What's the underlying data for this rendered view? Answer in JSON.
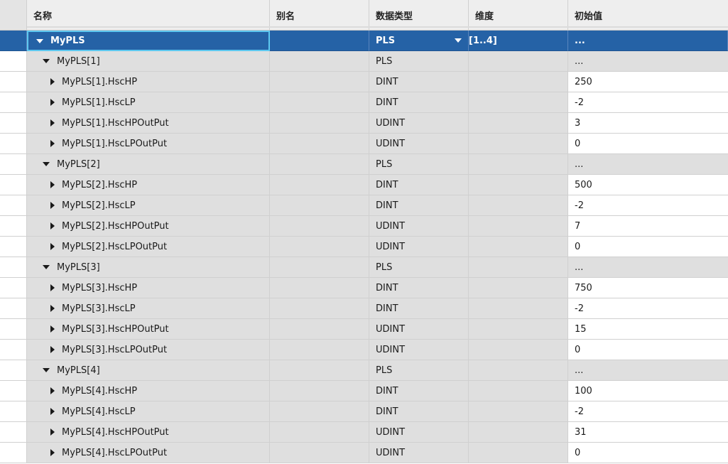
{
  "columns": {
    "name": "名称",
    "alias": "别名",
    "type": "数据类型",
    "dim": "维度",
    "init": "初始值"
  },
  "root": {
    "name": "MyPLS",
    "type": "PLS",
    "dim": "[1..4]",
    "init": "..."
  },
  "rows": [
    {
      "kind": "grp",
      "name": "MyPLS[1]",
      "type": "PLS",
      "init": "..."
    },
    {
      "kind": "leaf",
      "name": "MyPLS[1].HscHP",
      "type": "DINT",
      "init": "250"
    },
    {
      "kind": "leaf",
      "name": "MyPLS[1].HscLP",
      "type": "DINT",
      "init": "-2"
    },
    {
      "kind": "leaf",
      "name": "MyPLS[1].HscHPOutPut",
      "type": "UDINT",
      "init": "3"
    },
    {
      "kind": "leaf",
      "name": "MyPLS[1].HscLPOutPut",
      "type": "UDINT",
      "init": "0"
    },
    {
      "kind": "grp",
      "name": "MyPLS[2]",
      "type": "PLS",
      "init": "..."
    },
    {
      "kind": "leaf",
      "name": "MyPLS[2].HscHP",
      "type": "DINT",
      "init": "500"
    },
    {
      "kind": "leaf",
      "name": "MyPLS[2].HscLP",
      "type": "DINT",
      "init": "-2"
    },
    {
      "kind": "leaf",
      "name": "MyPLS[2].HscHPOutPut",
      "type": "UDINT",
      "init": "7"
    },
    {
      "kind": "leaf",
      "name": "MyPLS[2].HscLPOutPut",
      "type": "UDINT",
      "init": "0"
    },
    {
      "kind": "grp",
      "name": "MyPLS[3]",
      "type": "PLS",
      "init": "..."
    },
    {
      "kind": "leaf",
      "name": "MyPLS[3].HscHP",
      "type": "DINT",
      "init": "750"
    },
    {
      "kind": "leaf",
      "name": "MyPLS[3].HscLP",
      "type": "DINT",
      "init": "-2"
    },
    {
      "kind": "leaf",
      "name": "MyPLS[3].HscHPOutPut",
      "type": "UDINT",
      "init": "15"
    },
    {
      "kind": "leaf",
      "name": "MyPLS[3].HscLPOutPut",
      "type": "UDINT",
      "init": "0"
    },
    {
      "kind": "grp",
      "name": "MyPLS[4]",
      "type": "PLS",
      "init": "..."
    },
    {
      "kind": "leaf",
      "name": "MyPLS[4].HscHP",
      "type": "DINT",
      "init": "100"
    },
    {
      "kind": "leaf",
      "name": "MyPLS[4].HscLP",
      "type": "DINT",
      "init": "-2"
    },
    {
      "kind": "leaf",
      "name": "MyPLS[4].HscHPOutPut",
      "type": "UDINT",
      "init": "31"
    },
    {
      "kind": "leaf",
      "name": "MyPLS[4].HscLPOutPut",
      "type": "UDINT",
      "init": "0"
    }
  ],
  "colors": {
    "selected": "#2562a6",
    "selected_border": "#5ec8f0",
    "readonly_bg": "#dfdfdf",
    "header_bg": "#eeeeee"
  },
  "icons": {
    "expanded": "triangle-down-icon",
    "collapsed": "triangle-right-icon",
    "dropdown": "dropdown-arrow-icon"
  }
}
